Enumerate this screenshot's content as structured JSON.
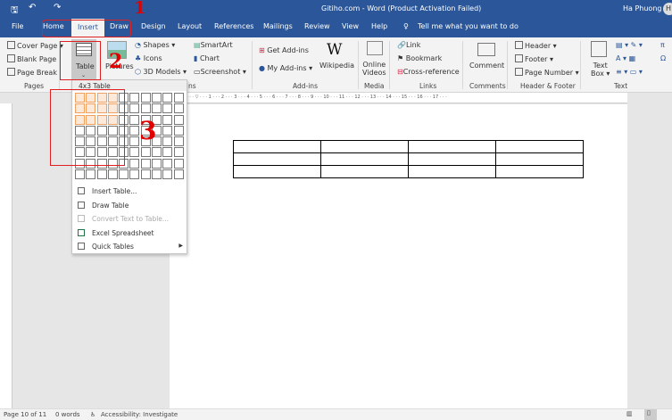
{
  "titlebar": {
    "title": "Gitiho.com - Word (Product Activation Failed)",
    "user": "Ha Phuong",
    "avatar": "H"
  },
  "tabs": [
    "File",
    "Home",
    "Insert",
    "Draw",
    "Design",
    "Layout",
    "References",
    "Mailings",
    "Review",
    "View",
    "Help"
  ],
  "tell_me": "Tell me what you want to do",
  "ribbon": {
    "pages": {
      "items": [
        "Cover Page",
        "Blank Page",
        "Page Break"
      ],
      "label": "Pages"
    },
    "table": "Table",
    "pictures": "Pictures",
    "illustrations": [
      "Shapes",
      "Icons",
      "3D Models",
      "SmartArt",
      "Chart",
      "Screenshot"
    ],
    "illustrations_label_fragment": "ns",
    "addins": {
      "items": [
        "Get Add-ins",
        "My Add-ins",
        "Wikipedia"
      ],
      "label": "Add-ins"
    },
    "media": {
      "items": [
        "Online",
        "Videos"
      ],
      "label": "Media"
    },
    "links": {
      "items": [
        "Link",
        "Bookmark",
        "Cross-reference"
      ],
      "label": "Links"
    },
    "comments": {
      "item": "Comment",
      "label": "Comments"
    },
    "header_footer": {
      "items": [
        "Header",
        "Footer",
        "Page Number"
      ],
      "label": "Header & Footer"
    },
    "text": {
      "items": [
        "Text",
        "Box"
      ],
      "label": "Text"
    }
  },
  "ruler": "2 · · · 1 · · · ▽ · · · 1 · · · 2 · · · 3 · · · 4 · · · 5 · · · 6 · · · 7 · · · 8 · · · 9 · · · 10 · · · 11 · · · 12 · · · 13 · · · 14 · · · 15 · · · 16 · · · 17 · · ·",
  "dropdown": {
    "header": "4x3 Table",
    "selected_cols": 4,
    "selected_rows": 3,
    "grid_cols": 10,
    "grid_rows": 8,
    "items": [
      {
        "label": "Insert Table...",
        "disabled": false
      },
      {
        "label": "Draw Table",
        "disabled": false
      },
      {
        "label": "Convert Text to Table...",
        "disabled": true
      },
      {
        "label": "Excel Spreadsheet",
        "disabled": false
      },
      {
        "label": "Quick Tables",
        "disabled": false,
        "submenu": true
      }
    ]
  },
  "document_table": {
    "cols": 4,
    "rows": 3
  },
  "annotations": [
    "1",
    "2",
    "3"
  ],
  "status": {
    "page": "Page 10 of 11",
    "words": "0 words",
    "accessibility": "Accessibility: Investigate"
  },
  "colors": {
    "brand": "#2b579a",
    "annotation": "#e02020",
    "selection": "#f0a060"
  }
}
